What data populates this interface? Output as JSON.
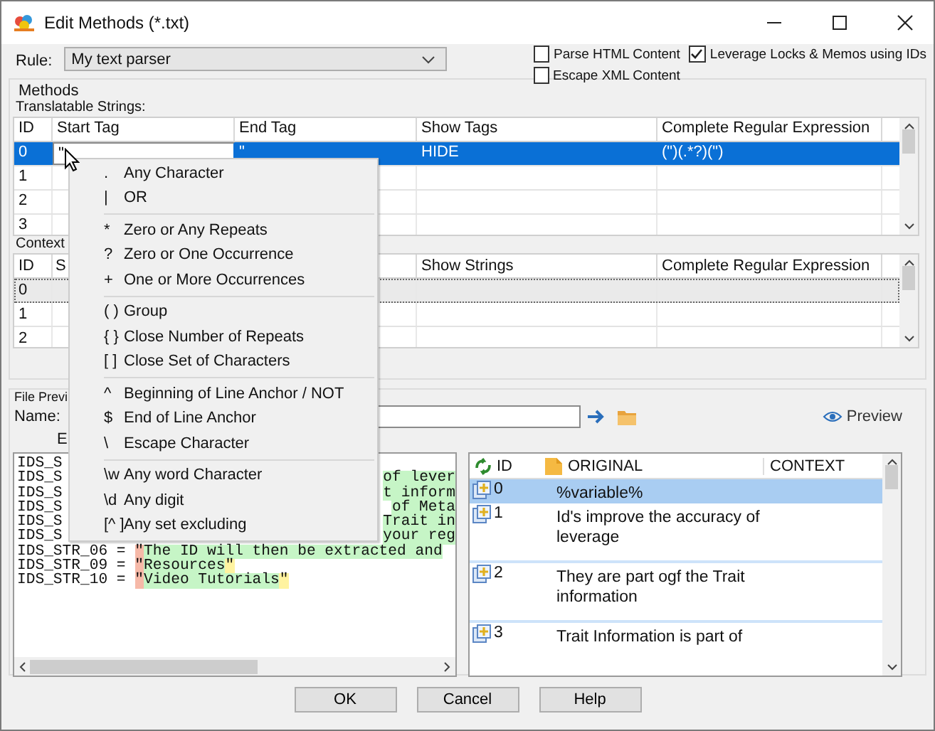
{
  "window": {
    "title": "Edit Methods (*.txt)"
  },
  "rule": {
    "label": "Rule:",
    "value": "My text parser"
  },
  "options": [
    {
      "label": "Parse HTML Content",
      "checked": false
    },
    {
      "label": "Leverage Locks & Memos using IDs",
      "checked": true
    },
    {
      "label": "Escape XML Content",
      "checked": false
    }
  ],
  "methods": {
    "title": "Methods",
    "translatable": {
      "label": "Translatable Strings:",
      "columns": [
        "ID",
        "Start Tag",
        "End Tag",
        "Show Tags",
        "Complete Regular Expression"
      ],
      "rows": [
        {
          "id": "0",
          "start_tag": "\"",
          "end_tag": "\"",
          "show_tags": "HIDE",
          "regex": "(\")(.*?)(\")",
          "selected": true,
          "editing": true
        },
        {
          "id": "1",
          "selected": false,
          "editing": false
        },
        {
          "id": "2",
          "selected": false,
          "editing": false
        },
        {
          "id": "3",
          "selected": false,
          "editing": false
        }
      ]
    },
    "context": {
      "label": "Context",
      "columns": [
        "ID",
        "S",
        "Show Strings",
        "Complete Regular Expression"
      ],
      "rows": [
        {
          "id": "0",
          "selected": true
        },
        {
          "id": "1",
          "selected": false
        },
        {
          "id": "2",
          "selected": false
        }
      ]
    }
  },
  "file_preview": {
    "title": "File Previ",
    "name_label": "Name:",
    "sub_label": "E",
    "preview_button": "Preview",
    "editor": {
      "lines": [
        {
          "segments": [
            {
              "kind": "key",
              "text": "IDS_S"
            }
          ]
        },
        {
          "segments": [
            {
              "kind": "key",
              "text": "IDS_S"
            },
            {
              "kind": "tail",
              "text": "of lever"
            }
          ]
        },
        {
          "segments": [
            {
              "kind": "key",
              "text": "IDS_S"
            },
            {
              "kind": "tail",
              "text": "t inform"
            }
          ]
        },
        {
          "segments": [
            {
              "kind": "key",
              "text": "IDS_S"
            },
            {
              "kind": "tail",
              "text": "of Meta"
            }
          ]
        },
        {
          "segments": [
            {
              "kind": "key",
              "text": "IDS_S"
            },
            {
              "kind": "tail",
              "text": "Trait in"
            }
          ]
        },
        {
          "segments": [
            {
              "kind": "key",
              "text": "IDS_S"
            },
            {
              "kind": "tail",
              "text": "your reg"
            }
          ]
        },
        {
          "segments": [
            {
              "kind": "key",
              "text": "IDS_STR_06 = "
            },
            {
              "kind": "open",
              "text": "\""
            },
            {
              "kind": "string",
              "text": "The ID will then be extracted and"
            }
          ]
        },
        {
          "segments": [
            {
              "kind": "key",
              "text": "IDS_STR_09 = "
            },
            {
              "kind": "open",
              "text": "\""
            },
            {
              "kind": "string",
              "text": "Resources"
            },
            {
              "kind": "close",
              "text": "\""
            }
          ]
        },
        {
          "segments": [
            {
              "kind": "key",
              "text": "IDS_STR_10 = "
            },
            {
              "kind": "open",
              "text": "\""
            },
            {
              "kind": "string",
              "text": "Video Tutorials"
            },
            {
              "kind": "close",
              "text": "\""
            }
          ]
        }
      ]
    },
    "list": {
      "columns": [
        "ID",
        "ORIGINAL",
        "CONTEXT"
      ],
      "rows": [
        {
          "id": "0",
          "original": "%variable%",
          "selected": true
        },
        {
          "id": "1",
          "original": "Id's improve the accuracy of leverage",
          "selected": false
        },
        {
          "id": "2",
          "original": "They are part ogf the Trait information",
          "selected": false
        },
        {
          "id": "3",
          "original": "Trait Information is part of",
          "selected": false
        }
      ]
    }
  },
  "context_menu": {
    "groups": [
      {
        "items": [
          {
            "symbol": ".",
            "label": "Any Character"
          },
          {
            "symbol": "|",
            "label": "OR"
          }
        ]
      },
      {
        "items": [
          {
            "symbol": "*",
            "label": "Zero or Any Repeats"
          },
          {
            "symbol": "?",
            "label": "Zero or One Occurrence"
          },
          {
            "symbol": "+",
            "label": "One or More Occurrences"
          }
        ]
      },
      {
        "items": [
          {
            "symbol": "( )",
            "label": "Group"
          },
          {
            "symbol": "{ }",
            "label": "Close Number of Repeats"
          },
          {
            "symbol": "[ ]",
            "label": "Close Set of Characters"
          }
        ]
      },
      {
        "items": [
          {
            "symbol": "^",
            "label": "Beginning of Line Anchor / NOT"
          },
          {
            "symbol": "$",
            "label": "End of Line Anchor"
          },
          {
            "symbol": "\\",
            "label": "Escape Character"
          }
        ]
      },
      {
        "items": [
          {
            "symbol": "\\w",
            "label": "Any word Character"
          },
          {
            "symbol": "\\d",
            "label": "Any digit"
          },
          {
            "symbol": "[^ ]",
            "label": "Any set excluding"
          }
        ]
      }
    ]
  },
  "buttons": [
    "OK",
    "Cancel",
    "Help"
  ]
}
